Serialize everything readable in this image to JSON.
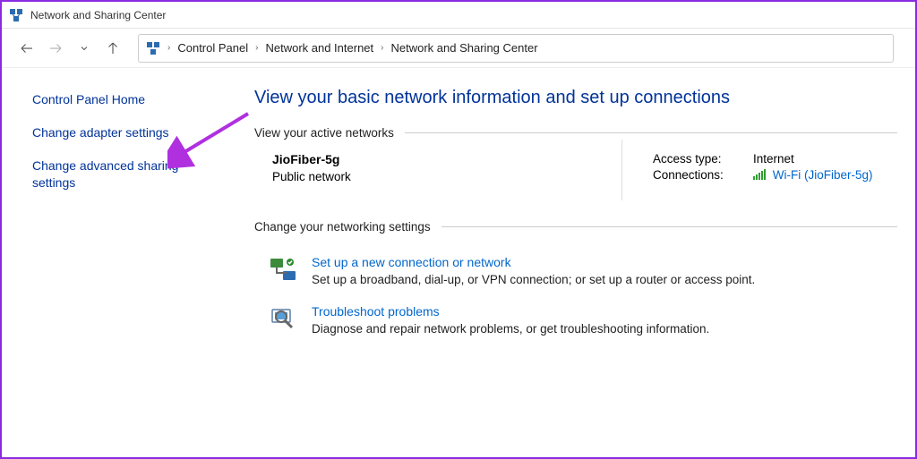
{
  "window": {
    "title": "Network and Sharing Center"
  },
  "breadcrumb": {
    "items": [
      "Control Panel",
      "Network and Internet",
      "Network and Sharing Center"
    ]
  },
  "sidebar": {
    "home": "Control Panel Home",
    "adapter": "Change adapter settings",
    "advanced": "Change advanced sharing settings"
  },
  "main": {
    "heading": "View your basic network information and set up connections",
    "section_active": "View your active networks",
    "network": {
      "name": "JioFiber-5g",
      "category": "Public network",
      "access_label": "Access type:",
      "access_value": "Internet",
      "conn_label": "Connections:",
      "conn_link": "Wi-Fi (JioFiber-5g)"
    },
    "section_change": "Change your networking settings",
    "setup": {
      "title": "Set up a new connection or network",
      "desc": "Set up a broadband, dial-up, or VPN connection; or set up a router or access point."
    },
    "troubleshoot": {
      "title": "Troubleshoot problems",
      "desc": "Diagnose and repair network problems, or get troubleshooting information."
    }
  }
}
